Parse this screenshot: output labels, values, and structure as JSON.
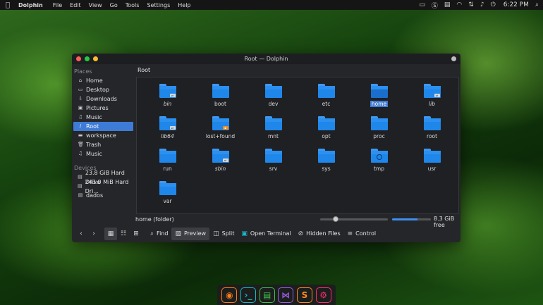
{
  "topbar": {
    "app_name": "Dolphin",
    "menu": [
      "File",
      "Edit",
      "View",
      "Go",
      "Tools",
      "Settings",
      "Help"
    ],
    "clock": "6:22 PM"
  },
  "window": {
    "title": "Root — Dolphin",
    "breadcrumb": "Root"
  },
  "sidebar": {
    "places_label": "Places",
    "places": [
      {
        "label": "Home",
        "icon": "home-icon"
      },
      {
        "label": "Desktop",
        "icon": "desktop-icon"
      },
      {
        "label": "Downloads",
        "icon": "download-icon"
      },
      {
        "label": "Pictures",
        "icon": "pictures-icon"
      },
      {
        "label": "Music",
        "icon": "music-icon"
      },
      {
        "label": "Root",
        "icon": "root-icon",
        "active": true
      },
      {
        "label": "workspace",
        "icon": "folder-icon"
      },
      {
        "label": "Trash",
        "icon": "trash-icon"
      },
      {
        "label": "Music",
        "icon": "music-icon"
      }
    ],
    "devices_label": "Devices",
    "devices": [
      {
        "label": "23.8 GiB Hard Drive",
        "icon": "drive-icon"
      },
      {
        "label": "243.0 MiB Hard Dri...",
        "icon": "drive-icon"
      },
      {
        "label": "dados",
        "icon": "drive-icon"
      }
    ]
  },
  "files": [
    {
      "name": "bin",
      "italic": true,
      "emblem": "link"
    },
    {
      "name": "boot"
    },
    {
      "name": "dev"
    },
    {
      "name": "etc"
    },
    {
      "name": "home",
      "selected": true
    },
    {
      "name": "lib",
      "italic": true,
      "emblem": "link"
    },
    {
      "name": "lib64",
      "italic": true,
      "emblem": "link"
    },
    {
      "name": "lost+found",
      "emblem": "locked"
    },
    {
      "name": "mnt"
    },
    {
      "name": "opt"
    },
    {
      "name": "proc"
    },
    {
      "name": "root"
    },
    {
      "name": "run"
    },
    {
      "name": "sbin",
      "italic": true,
      "emblem": "link"
    },
    {
      "name": "srv"
    },
    {
      "name": "sys"
    },
    {
      "name": "tmp",
      "emblem": "clock"
    },
    {
      "name": "usr"
    },
    {
      "name": "var"
    }
  ],
  "status": {
    "selection": "home (folder)",
    "free_space": "8.3 GiB free",
    "free_fraction": 0.65,
    "zoom_fraction": 0.2
  },
  "toolbar": {
    "find": "Find",
    "preview": "Preview",
    "split": "Split",
    "open_terminal": "Open Terminal",
    "hidden_files": "Hidden Files",
    "control": "Control"
  },
  "dock": [
    {
      "name": "firefox",
      "color": "#ff7a18"
    },
    {
      "name": "terminal",
      "color": "#1bb8c9"
    },
    {
      "name": "files",
      "color": "#3ec34a"
    },
    {
      "name": "visual-studio",
      "color": "#9b5de5"
    },
    {
      "name": "sublime-text",
      "color": "#ff8a1f"
    },
    {
      "name": "settings",
      "color": "#ff2f6e"
    }
  ],
  "colors": {
    "accent": "#3e7bd6",
    "folder": "#1f86ea"
  }
}
